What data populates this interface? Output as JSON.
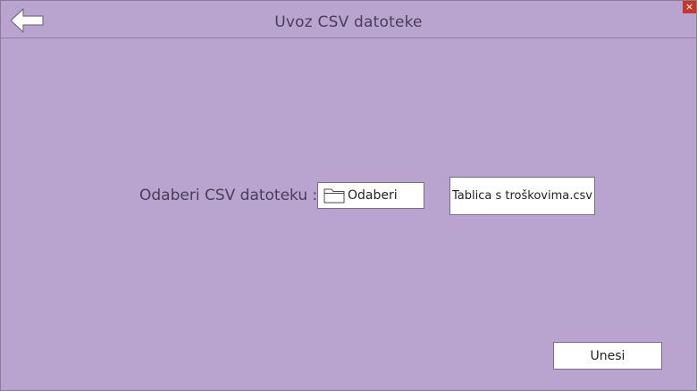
{
  "header": {
    "title": "Uvoz CSV datoteke",
    "back_icon": "arrow-left-icon",
    "close_label": "×"
  },
  "import": {
    "label": "Odaberi CSV datoteku :",
    "choose_button_label": "Odaberi",
    "choose_icon": "folder-icon",
    "selected_file": "Tablica s troškovima.csv"
  },
  "actions": {
    "submit_label": "Unesi"
  },
  "colors": {
    "background": "#b9a4cf",
    "text": "#4a3d56",
    "close": "#c0392b"
  }
}
